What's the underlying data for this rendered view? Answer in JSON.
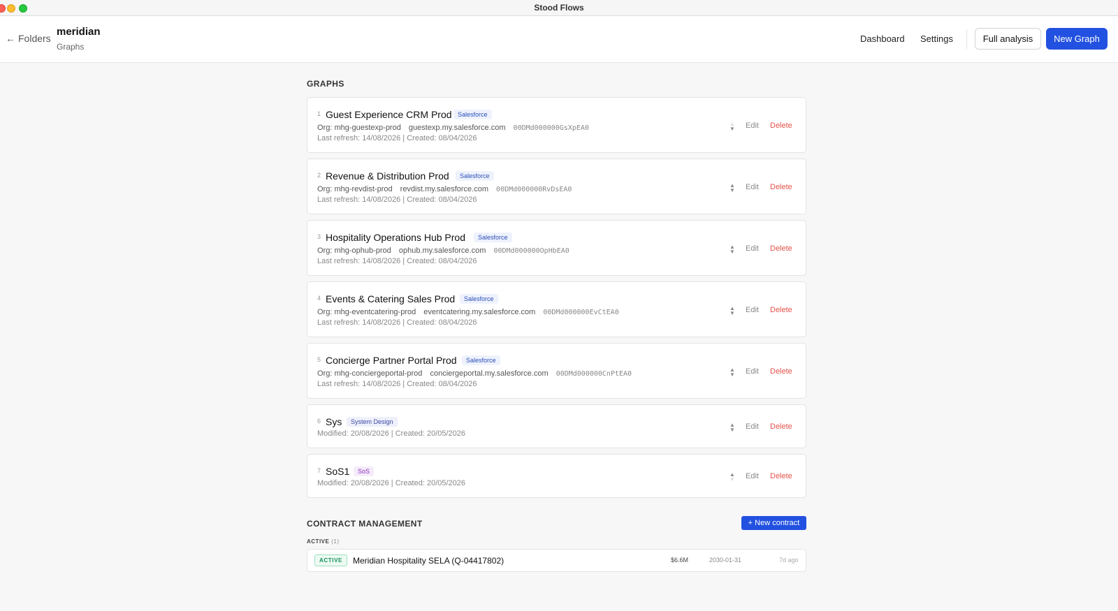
{
  "window": {
    "title": "Stood Flows"
  },
  "header": {
    "back_label": "Folders",
    "folder_name": "meridian",
    "folder_sub": "Graphs",
    "nav": {
      "dashboard": "Dashboard",
      "settings": "Settings"
    },
    "full_analysis": "Full analysis",
    "new_graph": "New Graph"
  },
  "graphs": {
    "section_title": "GRAPHS",
    "edit_label": "Edit",
    "delete_label": "Delete",
    "items": [
      {
        "num": "1",
        "name": "Guest Experience CRM Prod",
        "badge": "Salesforce",
        "org": "Org: mhg-guestexp-prod",
        "host": "guestexp.my.salesforce.com",
        "id": "00DMd000000GsXpEA0",
        "dates": "Last refresh: 14/08/2026 | Created: 08/04/2026"
      },
      {
        "num": "2",
        "name": "Revenue & Distribution Prod",
        "badge": "Salesforce",
        "org": "Org: mhg-revdist-prod",
        "host": "revdist.my.salesforce.com",
        "id": "00DMd000000RvDsEA0",
        "dates": "Last refresh: 14/08/2026 | Created: 08/04/2026"
      },
      {
        "num": "3",
        "name": "Hospitality Operations Hub Prod",
        "badge": "Salesforce",
        "org": "Org: mhg-ophub-prod",
        "host": "ophub.my.salesforce.com",
        "id": "00DMd000000OpHbEA0",
        "dates": "Last refresh: 14/08/2026 | Created: 08/04/2026"
      },
      {
        "num": "4",
        "name": "Events & Catering Sales Prod",
        "badge": "Salesforce",
        "org": "Org: mhg-eventcatering-prod",
        "host": "eventcatering.my.salesforce.com",
        "id": "00DMd000000EvCtEA0",
        "dates": "Last refresh: 14/08/2026 | Created: 08/04/2026"
      },
      {
        "num": "5",
        "name": "Concierge Partner Portal Prod",
        "badge": "Salesforce",
        "org": "Org: mhg-conciergeportal-prod",
        "host": "conciergeportal.my.salesforce.com",
        "id": "00DMd000000CnPtEA0",
        "dates": "Last refresh: 14/08/2026 | Created: 08/04/2026"
      },
      {
        "num": "6",
        "name": "Sys",
        "badge": "System Design",
        "dates": "Modified: 20/08/2026 | Created: 20/05/2026"
      },
      {
        "num": "7",
        "name": "SoS1",
        "badge": "SoS",
        "dates": "Modified: 20/08/2026 | Created: 20/05/2026"
      }
    ]
  },
  "contracts": {
    "section_title": "CONTRACT MANAGEMENT",
    "new_button": "+ New contract",
    "active_label": "ACTIVE",
    "active_count": "(1)",
    "rows": [
      {
        "status": "ACTIVE",
        "name": "Meridian Hospitality SELA (Q-04417802)",
        "value": "$6.6M",
        "date": "2030-01-31",
        "ago": "7d ago"
      }
    ]
  }
}
